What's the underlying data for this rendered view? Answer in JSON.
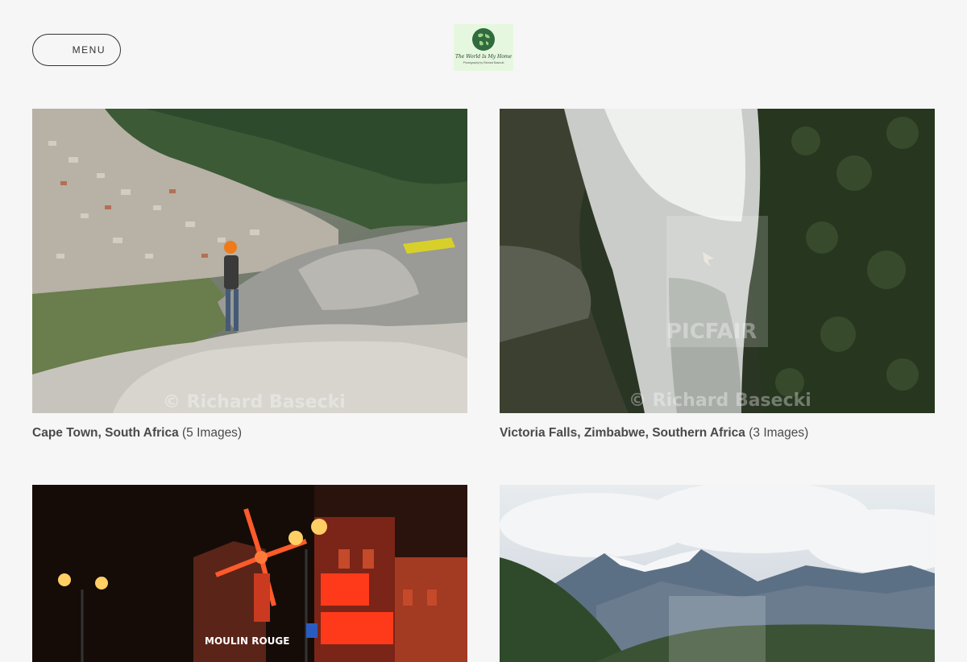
{
  "header": {
    "menu_label": "MENU",
    "logo_title": "The World Is My Home",
    "logo_subtitle": "Photography by Richard Basecki"
  },
  "galleries": [
    {
      "title": "Cape Town, South Africa",
      "count": "(5 Images)",
      "watermark": "© Richard Basecki"
    },
    {
      "title": "Victoria Falls, Zimbabwe, Southern Africa",
      "count": "(3 Images)",
      "watermark": "© Richard Basecki",
      "watermark_logo": "PICFAIR"
    },
    {
      "title": "",
      "count": "",
      "neon_sign": "MOULIN ROUGE"
    },
    {
      "title": "",
      "count": ""
    }
  ],
  "colors": {
    "background": "#f6f6f6",
    "text": "#4a4a4a",
    "menu_border": "#333333"
  }
}
